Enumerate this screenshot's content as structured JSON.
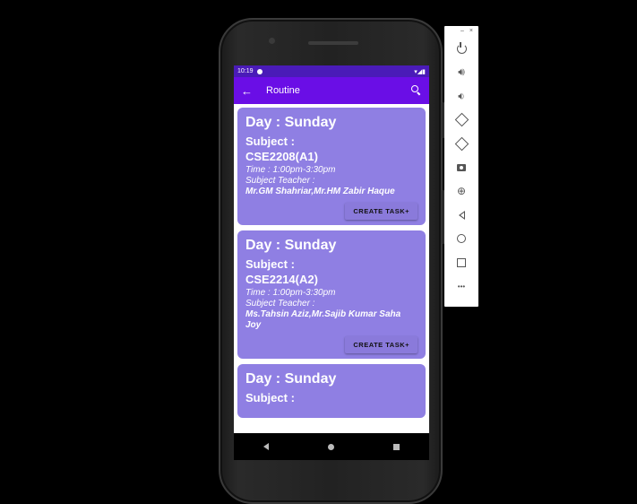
{
  "status_bar": {
    "time": "10:19",
    "icons": "▾◢▮"
  },
  "app_bar": {
    "back_icon": "←",
    "title": "Routine",
    "search_icon": "search-icon"
  },
  "cards": [
    {
      "day": "Day : Sunday",
      "subject_label": "Subject :",
      "subject": "CSE2208(A1)",
      "time": "Time : 1:00pm-3:30pm",
      "teacher_label": "Subject Teacher :",
      "teachers": "Mr.GM Shahriar,Mr.HM Zabir Haque",
      "button": "CREATE TASK+"
    },
    {
      "day": "Day : Sunday",
      "subject_label": "Subject :",
      "subject": "CSE2214(A2)",
      "time": "Time : 1:00pm-3:30pm",
      "teacher_label": "Subject Teacher :",
      "teachers": "Ms.Tahsin Aziz,Mr.Sajib Kumar Saha Joy",
      "button": "CREATE TASK+"
    },
    {
      "day": "Day : Sunday",
      "subject_label": "Subject :"
    }
  ],
  "toolbar": {
    "minimize": "–",
    "close": "×",
    "more": "•••"
  },
  "colors": {
    "app_bar": "#6a0ee6",
    "status_bar": "#4a1bb8",
    "card": "#8f7fe3"
  }
}
